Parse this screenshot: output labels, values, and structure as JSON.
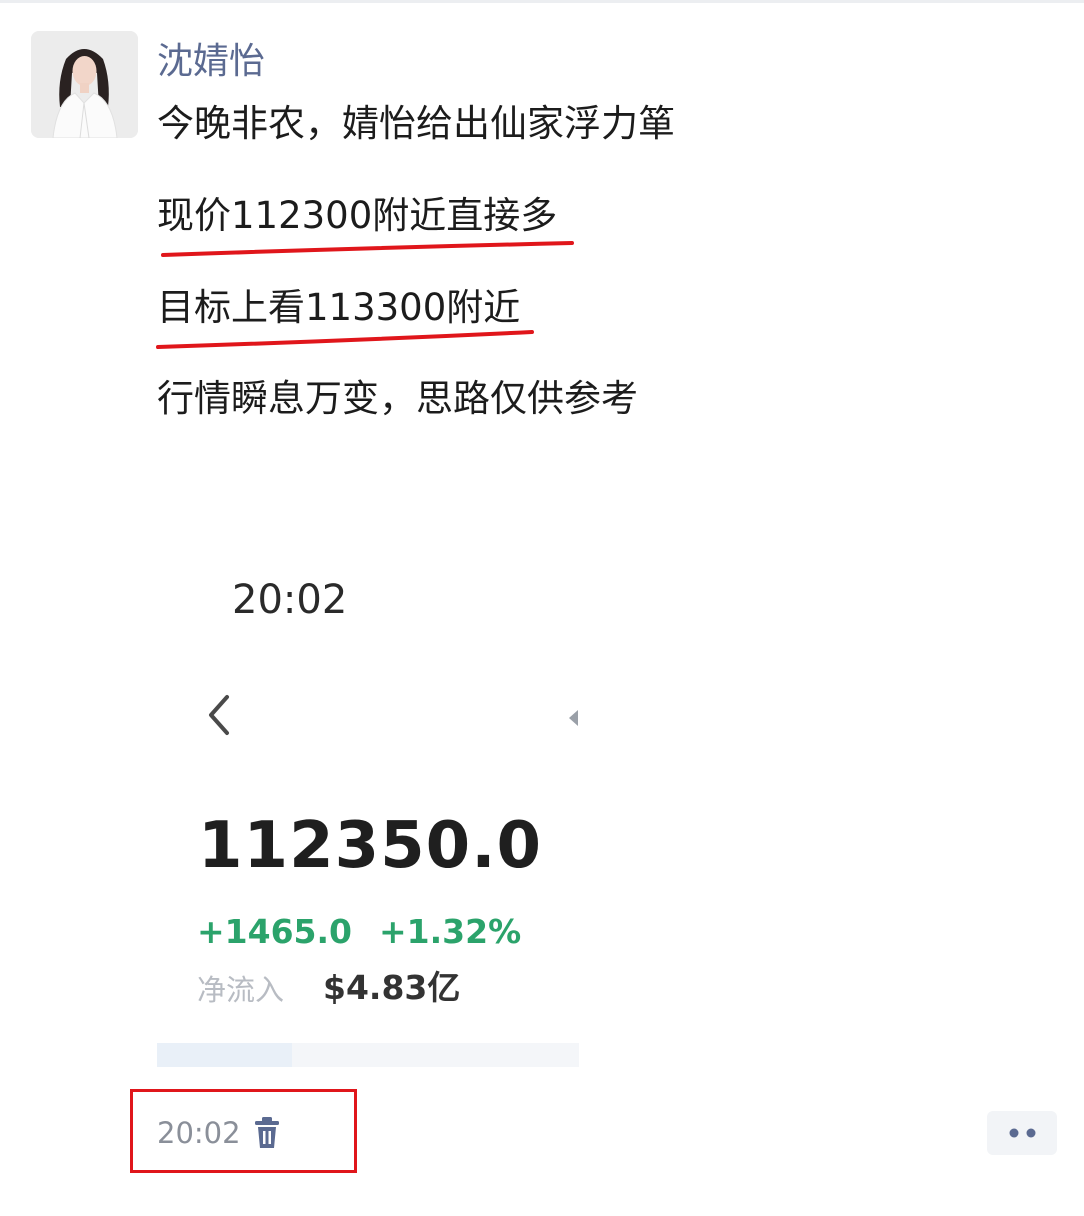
{
  "post": {
    "author": "沈婧怡",
    "lines": [
      "今晚非农，婧怡给出仙家浮力箪",
      "现价112300附近直接多",
      "目标上看113300附近",
      "行情瞬息万变，思路仅供参考"
    ],
    "timestamp": "20:02"
  },
  "screenshot": {
    "time": "20:02",
    "price": "112350.0",
    "change_abs": "+1465.0",
    "change_pct": "+1.32%",
    "net_flow_label": "净流入",
    "net_flow_value": "$4.83亿",
    "progress_fraction": 0.32
  },
  "icons": {
    "avatar": "profile-photo",
    "back": "chevron-left-icon",
    "right": "triangle-right-icon",
    "delete": "trash-icon",
    "more": "more-dots-icon"
  },
  "colors": {
    "author": "#5b6a91",
    "underline": "#e0161b",
    "positive": "#2ba36b",
    "highlight_border": "#e0161b"
  }
}
